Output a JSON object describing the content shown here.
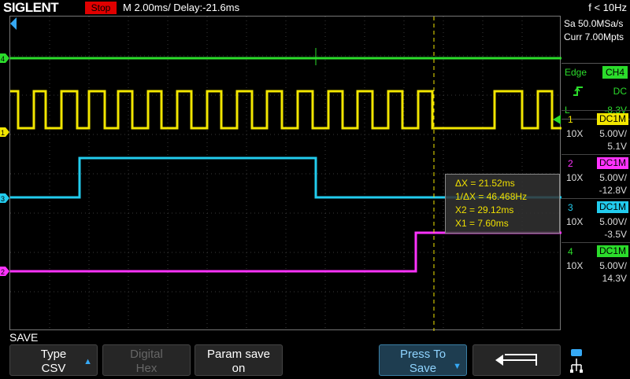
{
  "header": {
    "logo": "SIGLENT",
    "run_state": "Stop",
    "timebase": "M 2.00ms/ Delay:-21.6ms",
    "frequency": "f < 10Hz"
  },
  "acquisition": {
    "sample_rate": "Sa 50.0MSa/s",
    "memory": "Curr 7.00Mpts"
  },
  "trigger": {
    "type": "Edge",
    "source": "CH4",
    "coupling": "DC",
    "level_label": "L",
    "level": "-8.3V"
  },
  "channels": [
    {
      "num": "1",
      "coupling": "DC1M",
      "probe": "10X",
      "scale": "5.00V/",
      "offset": "5.1V",
      "color": "#f2e600"
    },
    {
      "num": "2",
      "coupling": "DC1M",
      "probe": "10X",
      "scale": "5.00V/",
      "offset": "-12.8V",
      "color": "#ff33ff"
    },
    {
      "num": "3",
      "coupling": "DC1M",
      "probe": "10X",
      "scale": "5.00V/",
      "offset": "-3.5V",
      "color": "#22ccee"
    },
    {
      "num": "4",
      "coupling": "DC1M",
      "probe": "10X",
      "scale": "5.00V/",
      "offset": "14.3V",
      "color": "#2bdc2b"
    }
  ],
  "markers": {
    "ch1": "1",
    "ch2": "2",
    "ch3": "3",
    "ch4": "4"
  },
  "cursors": {
    "delta_x": "ΔX = 21.52ms",
    "inv_delta_x": "1/ΔX = 46.468Hz",
    "x2": "X2 = 29.12ms",
    "x1": "X1 = 7.60ms"
  },
  "menu": {
    "title": "SAVE",
    "softkeys": [
      {
        "line1": "Type",
        "line2": "CSV"
      },
      {
        "line1": "Digital",
        "line2": "Hex"
      },
      {
        "line1": "Param save",
        "line2": "on"
      },
      {
        "line1": "Press To",
        "line2": "Save"
      }
    ]
  },
  "icons": {
    "back": "return-arrow-icon",
    "usb": "usb-icon"
  }
}
